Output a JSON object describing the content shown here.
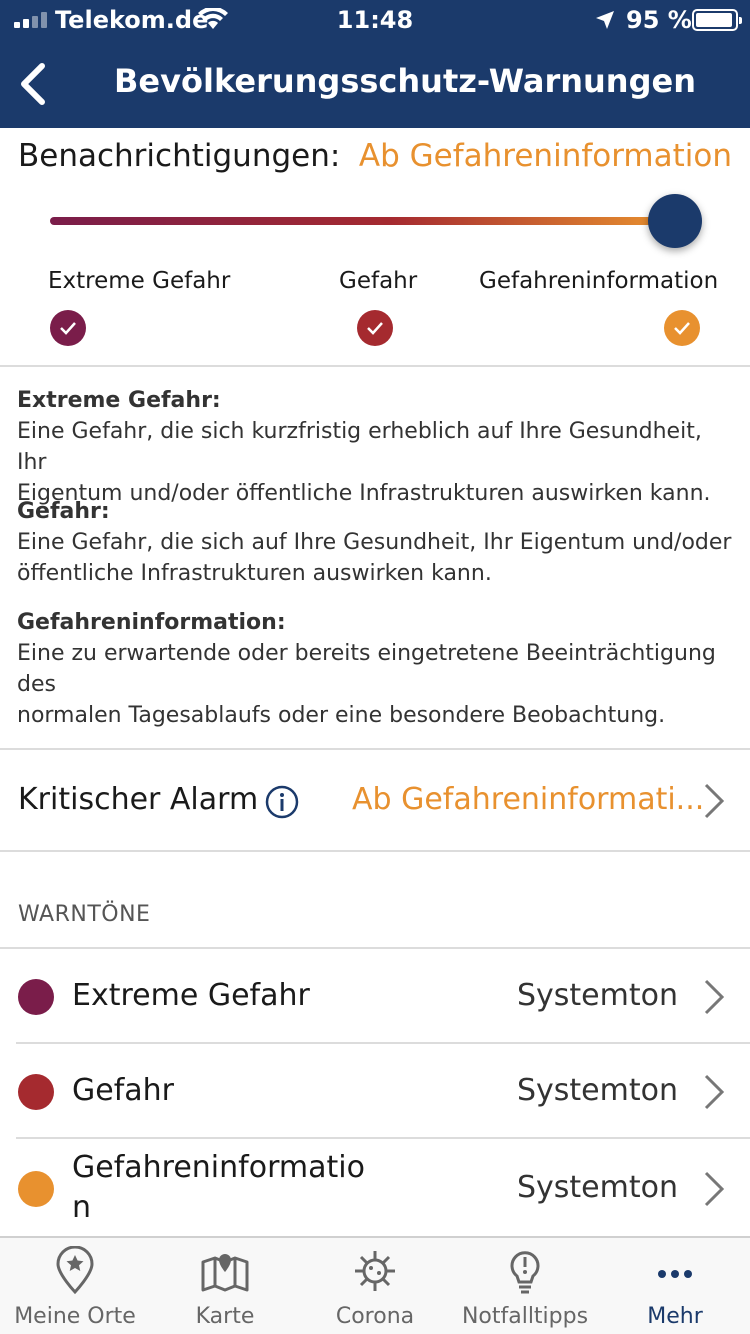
{
  "status_bar": {
    "carrier": "Telekom.de",
    "time": "11:48",
    "battery": "95 %"
  },
  "nav": {
    "title": "Bevölkerungsschutz-Warnungen"
  },
  "notifications": {
    "label": "Benachrichtigungen:",
    "value": "Ab Gefahreninformation",
    "slider_level": 1.0,
    "levels": [
      {
        "label": "Extreme Gefahr",
        "color": "#7a1d4a",
        "checked": true
      },
      {
        "label": "Gefahr",
        "color": "#a52a2f",
        "checked": true
      },
      {
        "label": "Gefahreninformation",
        "color": "#e8912f",
        "checked": true
      }
    ]
  },
  "definitions": [
    {
      "title": "Extreme Gefahr:",
      "lines": [
        "Eine Gefahr, die sich kurzfristig erheblich auf Ihre Gesundheit, Ihr",
        "Eigentum und/oder öffentliche Infrastrukturen auswirken kann."
      ]
    },
    {
      "title": "Gefahr:",
      "lines": [
        "Eine Gefahr, die sich auf Ihre Gesundheit, Ihr Eigentum und/oder",
        "öffentliche Infrastrukturen auswirken kann."
      ]
    },
    {
      "title": "Gefahreninformation:",
      "lines": [
        "Eine zu erwartende oder bereits eingetretene Beeinträchtigung des",
        "normalen Tagesablaufs oder eine besondere Beobachtung."
      ]
    }
  ],
  "critical_alarm": {
    "label": "Kritischer Alarm",
    "value": "Ab Gefahreninformati..."
  },
  "warning_tones": {
    "heading": "WARNTÖNE",
    "items": [
      {
        "name": "Extreme Gefahr",
        "value": "Systemton",
        "color": "#7a1d4a"
      },
      {
        "name": "Gefahr",
        "value": "Systemton",
        "color": "#a52a2f"
      },
      {
        "name_line1": "Gefahreninformatio",
        "name_line2": "n",
        "value": "Systemton",
        "color": "#e8912f"
      }
    ]
  },
  "tabs": [
    {
      "label": "Meine Orte",
      "icon": "location-pin-star-icon"
    },
    {
      "label": "Karte",
      "icon": "map-icon"
    },
    {
      "label": "Corona",
      "icon": "virus-icon"
    },
    {
      "label": "Notfalltipps",
      "icon": "lightbulb-icon"
    },
    {
      "label": "Mehr",
      "icon": "more-dots-icon",
      "active": true
    }
  ]
}
